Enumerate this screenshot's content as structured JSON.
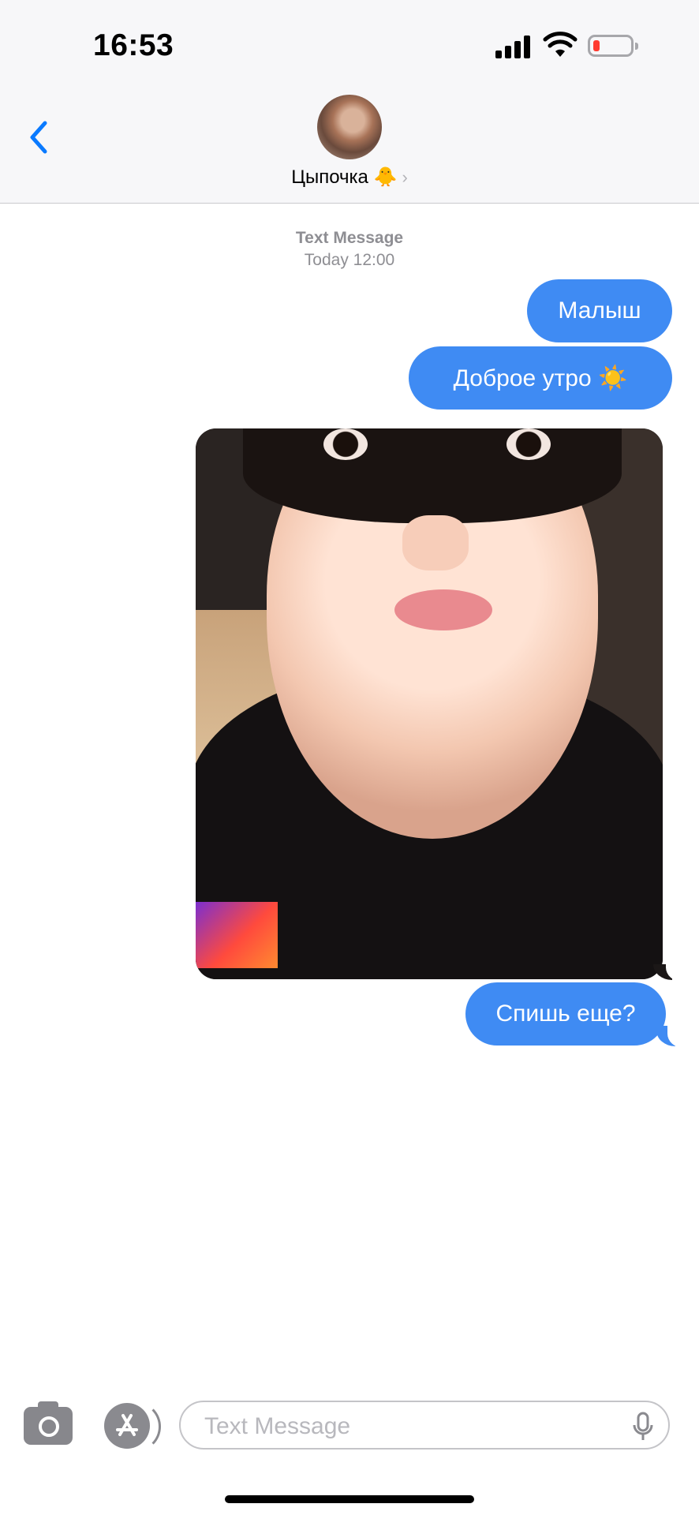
{
  "status_bar": {
    "time": "16:53",
    "battery_color": "#ff3b30"
  },
  "header": {
    "contact_name": "Цыпочка 🐥",
    "chevron": "›",
    "back_icon": "chevron-left-icon",
    "accent_color": "#0a7aff"
  },
  "conversation": {
    "service": "Text Message",
    "timestamp": "Today 12:00",
    "bubble_color": "#3f8bf3",
    "messages": [
      {
        "text": "Малыш"
      },
      {
        "text": "Доброе утро ☀️"
      },
      {
        "type": "photo"
      },
      {
        "text": "Спишь еще?"
      }
    ]
  },
  "input_bar": {
    "placeholder": "Text Message",
    "camera_icon": "camera-icon",
    "apps_icon": "app-store-icon",
    "mic_icon": "microphone-icon"
  }
}
